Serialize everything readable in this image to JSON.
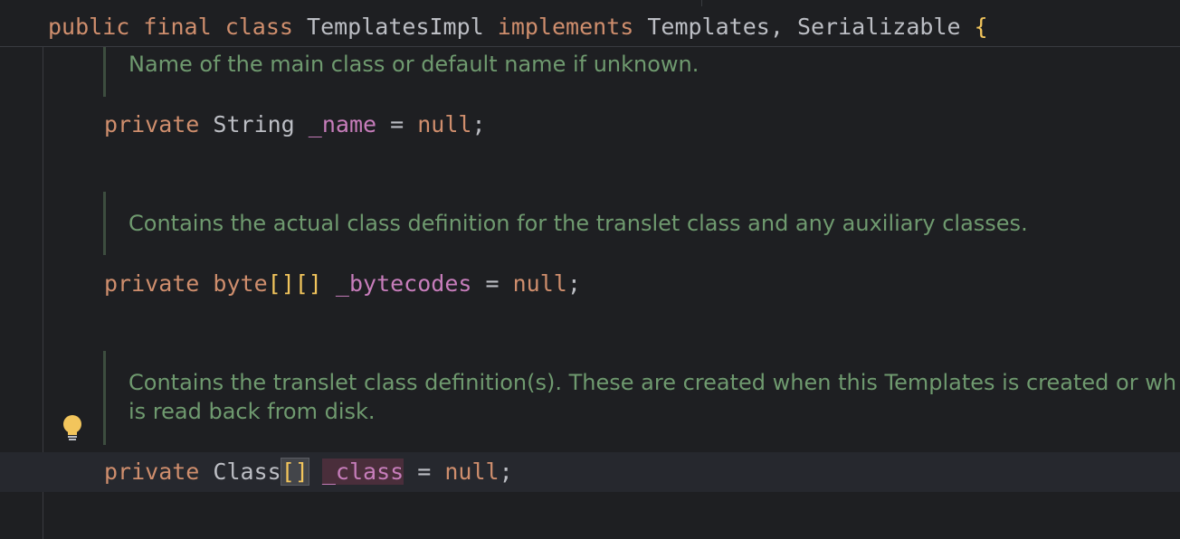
{
  "sticky_header": {
    "kw_public": "public",
    "kw_final": "final",
    "kw_class": "class",
    "class_name": "TemplatesImpl",
    "kw_implements": "implements",
    "iface1": "Templates",
    "comma": ",",
    "iface2": "Serializable",
    "brace": "{"
  },
  "doc1": "Name of the main class or default name if unknown.",
  "line1": {
    "kw": "private",
    "type": "String",
    "name": "_name",
    "eq": "=",
    "val": "null",
    "semi": ";"
  },
  "doc2": "Contains the actual class definition for the translet class and any auxiliary classes.",
  "line2": {
    "kw": "private",
    "type": "byte",
    "brackets": "[][]",
    "name": "_bytecodes",
    "eq": "=",
    "val": "null",
    "semi": ";"
  },
  "doc3": {
    "line_a": "Contains the translet class definition(s). These are created when this Templates is created or wh",
    "line_b": "is read back from disk."
  },
  "line3": {
    "kw": "private",
    "type": "Class",
    "brackets": "[]",
    "name": "_class",
    "eq": "=",
    "val": "null",
    "semi": ";"
  },
  "icons": {
    "bulb": "lightbulb-icon"
  },
  "colors": {
    "background": "#1e1f22",
    "keyword": "#cf8e6d",
    "field": "#c77dbb",
    "doc": "#6f9a6f",
    "brace": "#f2c55c"
  }
}
